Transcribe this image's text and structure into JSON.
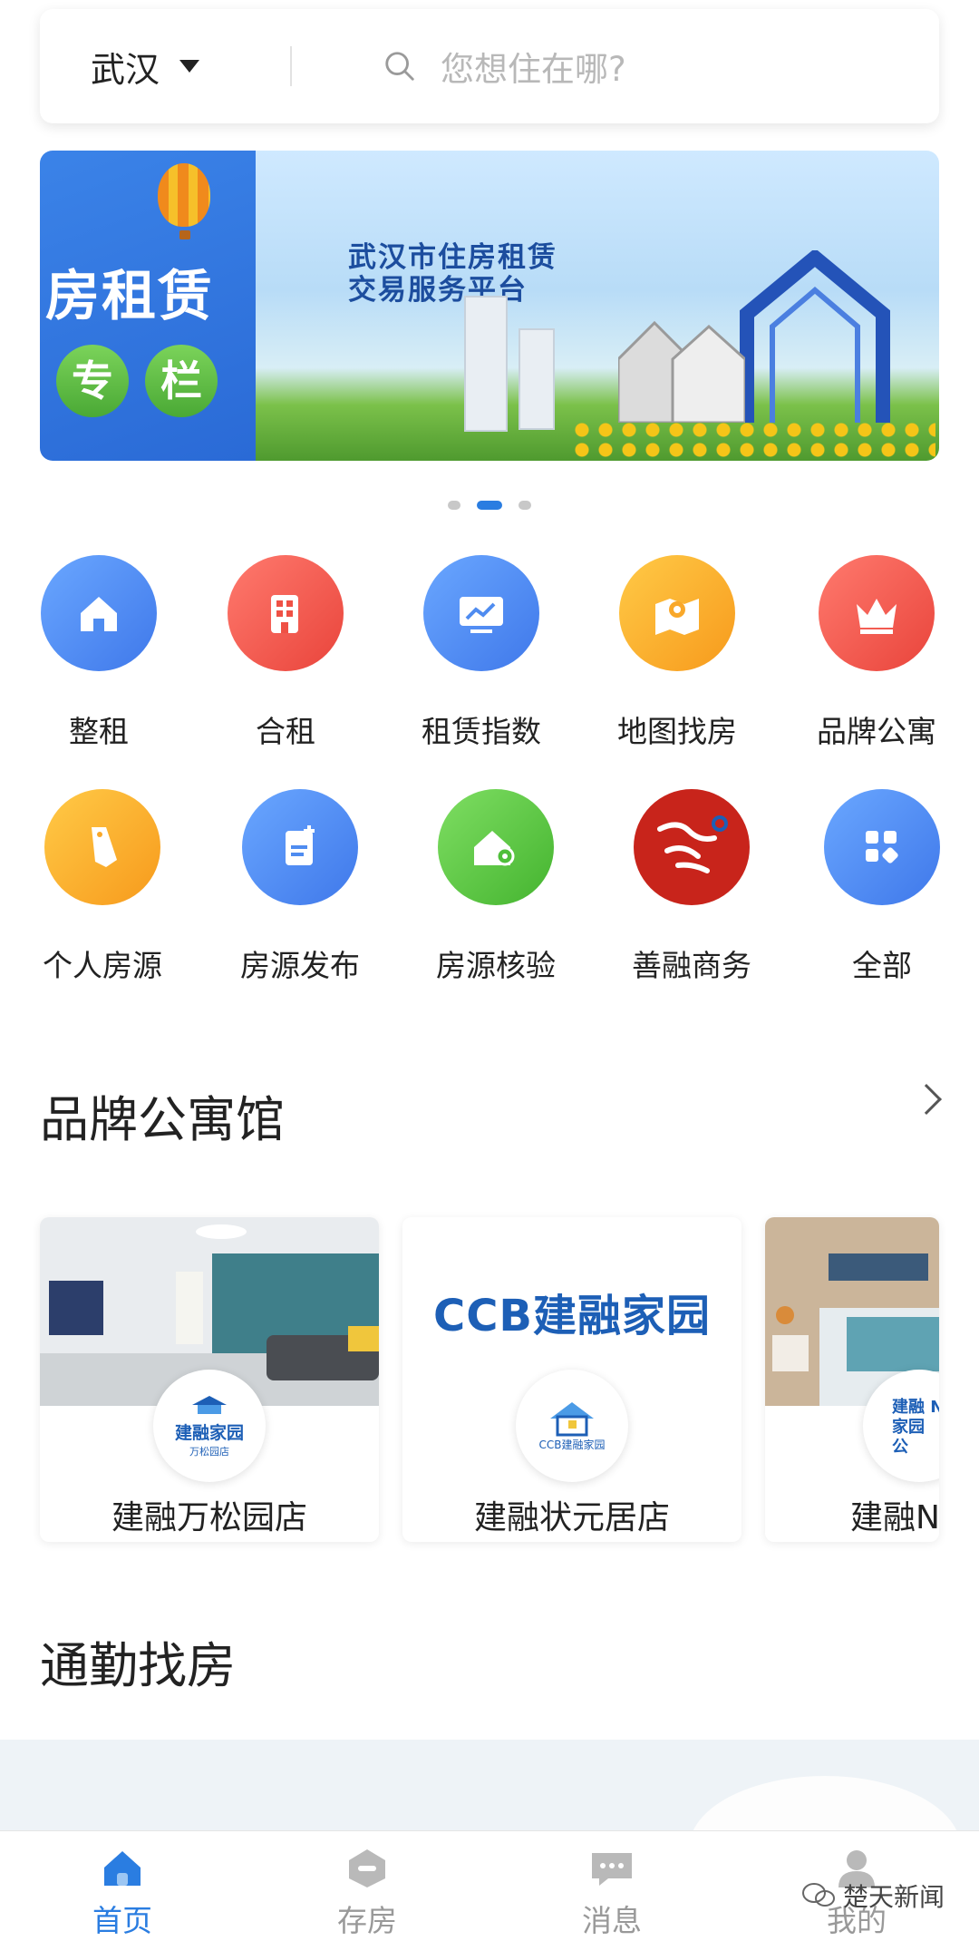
{
  "search": {
    "city": "武汉",
    "placeholder": "您想住在哪?"
  },
  "banner": {
    "left_title": "房租赁",
    "left_chars": [
      "专",
      "栏"
    ],
    "title_line1": "武汉市住房租赁",
    "title_line2": "交易服务平台",
    "page_count": 3,
    "active_page": 2
  },
  "quick_menu": [
    {
      "label": "整租",
      "icon": "house-icon",
      "color": "#4f8cf0"
    },
    {
      "label": "合租",
      "icon": "building-icon",
      "color": "#ef5145"
    },
    {
      "label": "租赁指数",
      "icon": "chart-icon",
      "color": "#4f8cf0"
    },
    {
      "label": "地图找房",
      "icon": "map-pin-icon",
      "color": "#f9a82a"
    },
    {
      "label": "品牌公寓",
      "icon": "crown-icon",
      "color": "#ef5145"
    },
    {
      "label": "个人房源",
      "icon": "tag-icon",
      "color": "#f9a82a"
    },
    {
      "label": "房源发布",
      "icon": "document-add-icon",
      "color": "#4f8cf0"
    },
    {
      "label": "房源核验",
      "icon": "house-key-icon",
      "color": "#4fbf3a"
    },
    {
      "label": "善融商务",
      "icon": "shanrong-logo-icon",
      "color": "#c8241b"
    },
    {
      "label": "全部",
      "icon": "grid-icon",
      "color": "#4f8cf0"
    }
  ],
  "brand_section": {
    "title": "品牌公寓馆",
    "cards": [
      {
        "name": "建融万松园店",
        "logo_text": "建融家园",
        "logo_sub": "万松园店"
      },
      {
        "name": "建融状元居店",
        "banner_text": "CCB建融家园",
        "logo_text": "CCB建融家园"
      },
      {
        "name": "建融N",
        "logo_text": "建融 N 家园 公"
      }
    ]
  },
  "commute_section": {
    "title": "通勤找房"
  },
  "bottom_nav": [
    {
      "label": "首页",
      "icon": "home-icon",
      "active": true
    },
    {
      "label": "存房",
      "icon": "save-house-icon",
      "active": false
    },
    {
      "label": "消息",
      "icon": "message-icon",
      "active": false
    },
    {
      "label": "我的",
      "icon": "user-icon",
      "active": false
    }
  ],
  "watermark": "楚天新闻",
  "colors": {
    "accent": "#2a7de1",
    "text": "#222222",
    "placeholder": "#b8b8b8"
  }
}
